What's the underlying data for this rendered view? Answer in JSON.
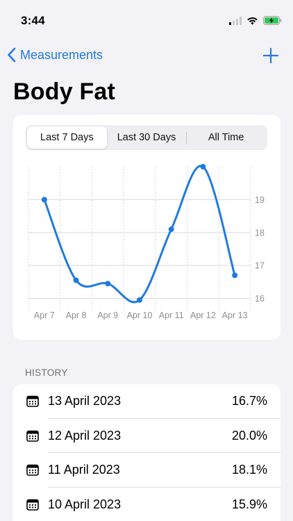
{
  "status": {
    "time": "3:44"
  },
  "nav": {
    "back_label": "Measurements"
  },
  "page": {
    "title": "Body Fat"
  },
  "segments": [
    {
      "label": "Last 7 Days",
      "selected": true
    },
    {
      "label": "Last 30 Days",
      "selected": false
    },
    {
      "label": "All Time",
      "selected": false
    }
  ],
  "colors": {
    "accent": "#1f7ae0",
    "line": "#1f7ae0"
  },
  "chart_data": {
    "type": "line",
    "categories": [
      "Apr 7",
      "Apr 8",
      "Apr 9",
      "Apr 10",
      "Apr 11",
      "Apr 12",
      "Apr 13"
    ],
    "values": [
      19.0,
      16.55,
      16.45,
      15.95,
      18.1,
      20.0,
      16.7
    ],
    "y_ticks": [
      "16",
      "17",
      "18",
      "19"
    ],
    "ylim": [
      15.8,
      20.0
    ],
    "grid": true
  },
  "history": {
    "header": "HISTORY",
    "rows": [
      {
        "date": "13 April 2023",
        "value": "16.7%"
      },
      {
        "date": "12 April 2023",
        "value": "20.0%"
      },
      {
        "date": "11 April 2023",
        "value": "18.1%"
      },
      {
        "date": "10 April 2023",
        "value": "15.9%"
      }
    ]
  }
}
